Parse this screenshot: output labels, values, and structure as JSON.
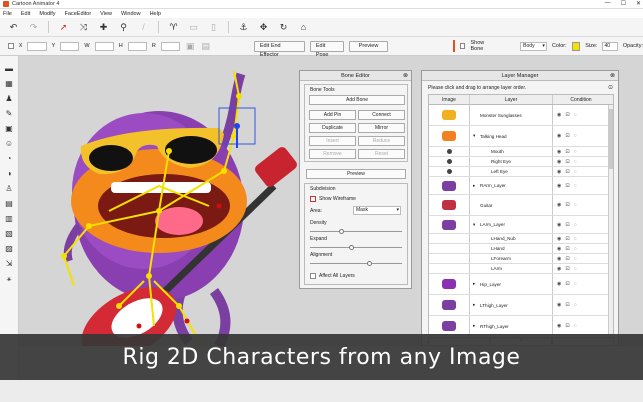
{
  "app": {
    "title": "Cartoon Animator 4"
  },
  "window_controls": {
    "minimize": "—",
    "maximize": "☐",
    "close": "✕"
  },
  "menu": [
    "File",
    "Edit",
    "Modify",
    "FaceEditor",
    "View",
    "Window",
    "Help"
  ],
  "toolbar2": {
    "edit_end_effector": "Edit End Effector",
    "edit_pose": "Edit Pose",
    "preview": "Preview",
    "show_bone_label": "Show Bone",
    "bone_select": "Body",
    "color_label": "Color:",
    "color_value": "#f5e000",
    "size_label": "Size:",
    "size_value": "40",
    "opacity_label": "Opacity:"
  },
  "bone_editor": {
    "title": "Bone Editor",
    "bone_tools_label": "Bone Tools",
    "buttons": {
      "add_bone": "Add Bone",
      "add_pin": "Add Pin",
      "connect": "Connect",
      "duplicate": "Duplicate",
      "mirror": "Mirror",
      "insert": "Insert",
      "reduce": "Reduce",
      "remove": "Remove",
      "reset": "Reset"
    },
    "preview_button": "Preview",
    "subdivision_label": "Subdivision",
    "show_wireframe": "Show Wireframe",
    "area_label": "Area:",
    "area_value": "Mask",
    "density_label": "Density",
    "expand_label": "Expand",
    "alignment_label": "Alignment",
    "affect_all_layers": "Affect All Layers"
  },
  "layer_manager": {
    "title": "Layer Manager",
    "hint": "Please click and drag to arrange layer order.",
    "columns": [
      "Image",
      "Layer",
      "Condition"
    ],
    "rows": [
      {
        "name": "Monster Sunglasses",
        "indent": 0,
        "arrow": "",
        "thumb": "#f2b020",
        "h": 21
      },
      {
        "name": "Talking Head",
        "indent": 0,
        "arrow": "▾",
        "thumb": "#f08020",
        "h": 21
      },
      {
        "name": "Mouth",
        "indent": 1,
        "arrow": "",
        "thumb": "#444",
        "h": 10
      },
      {
        "name": "Right Eye",
        "indent": 1,
        "arrow": "",
        "thumb": "#444",
        "h": 10
      },
      {
        "name": "Left Eye",
        "indent": 1,
        "arrow": "",
        "thumb": "#444",
        "h": 10
      },
      {
        "name": "RArm_Layer",
        "indent": 0,
        "arrow": "▸",
        "thumb": "#7a3fa0",
        "h": 18
      },
      {
        "name": "Guitar",
        "indent": 0,
        "arrow": "",
        "thumb": "#c03040",
        "h": 21
      },
      {
        "name": "LArm_Layer",
        "indent": 0,
        "arrow": "▾",
        "thumb": "#7a3fa0",
        "h": 18
      },
      {
        "name": "LHand_Nub",
        "indent": 1,
        "arrow": "",
        "thumb": "",
        "h": 10
      },
      {
        "name": "LHand",
        "indent": 1,
        "arrow": "",
        "thumb": "",
        "h": 10
      },
      {
        "name": "LForearm",
        "indent": 1,
        "arrow": "",
        "thumb": "",
        "h": 10
      },
      {
        "name": "LArm",
        "indent": 1,
        "arrow": "",
        "thumb": "",
        "h": 10
      },
      {
        "name": "Hip_Layer",
        "indent": 0,
        "arrow": "▸",
        "thumb": "#8a30b0",
        "h": 21
      },
      {
        "name": "LThigh_Layer",
        "indent": 0,
        "arrow": "▸",
        "thumb": "#7a3fa0",
        "h": 21
      },
      {
        "name": "RThigh_Layer",
        "indent": 0,
        "arrow": "▸",
        "thumb": "#7a3fa0",
        "h": 21
      }
    ],
    "add_button": "+"
  },
  "banner": {
    "text": "Rig 2D Characters from any Image"
  }
}
